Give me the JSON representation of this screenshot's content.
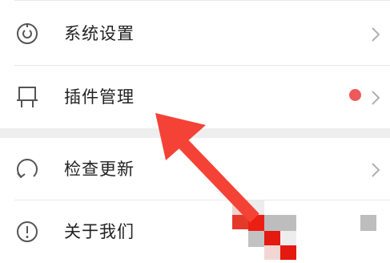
{
  "menu": {
    "items": [
      {
        "label": "系统设置",
        "icon": "settings-icon",
        "chevron": true
      },
      {
        "label": "插件管理",
        "icon": "plugin-icon",
        "chevron": true,
        "badge": "red-dot"
      },
      {
        "label": "检查更新",
        "icon": "update-icon",
        "chevron": true
      },
      {
        "label": "关于我们",
        "icon": "info-icon",
        "chevron": false
      }
    ]
  },
  "annotation": {
    "type": "red-arrow",
    "color": "#f44336",
    "points_to": "插件管理"
  },
  "colors": {
    "badge": "#ee5a5a",
    "divider": "#e8e8e8",
    "section_gap": "#eeeeee",
    "text": "#222222",
    "icon": "#555555",
    "arrow": "#f44336"
  }
}
